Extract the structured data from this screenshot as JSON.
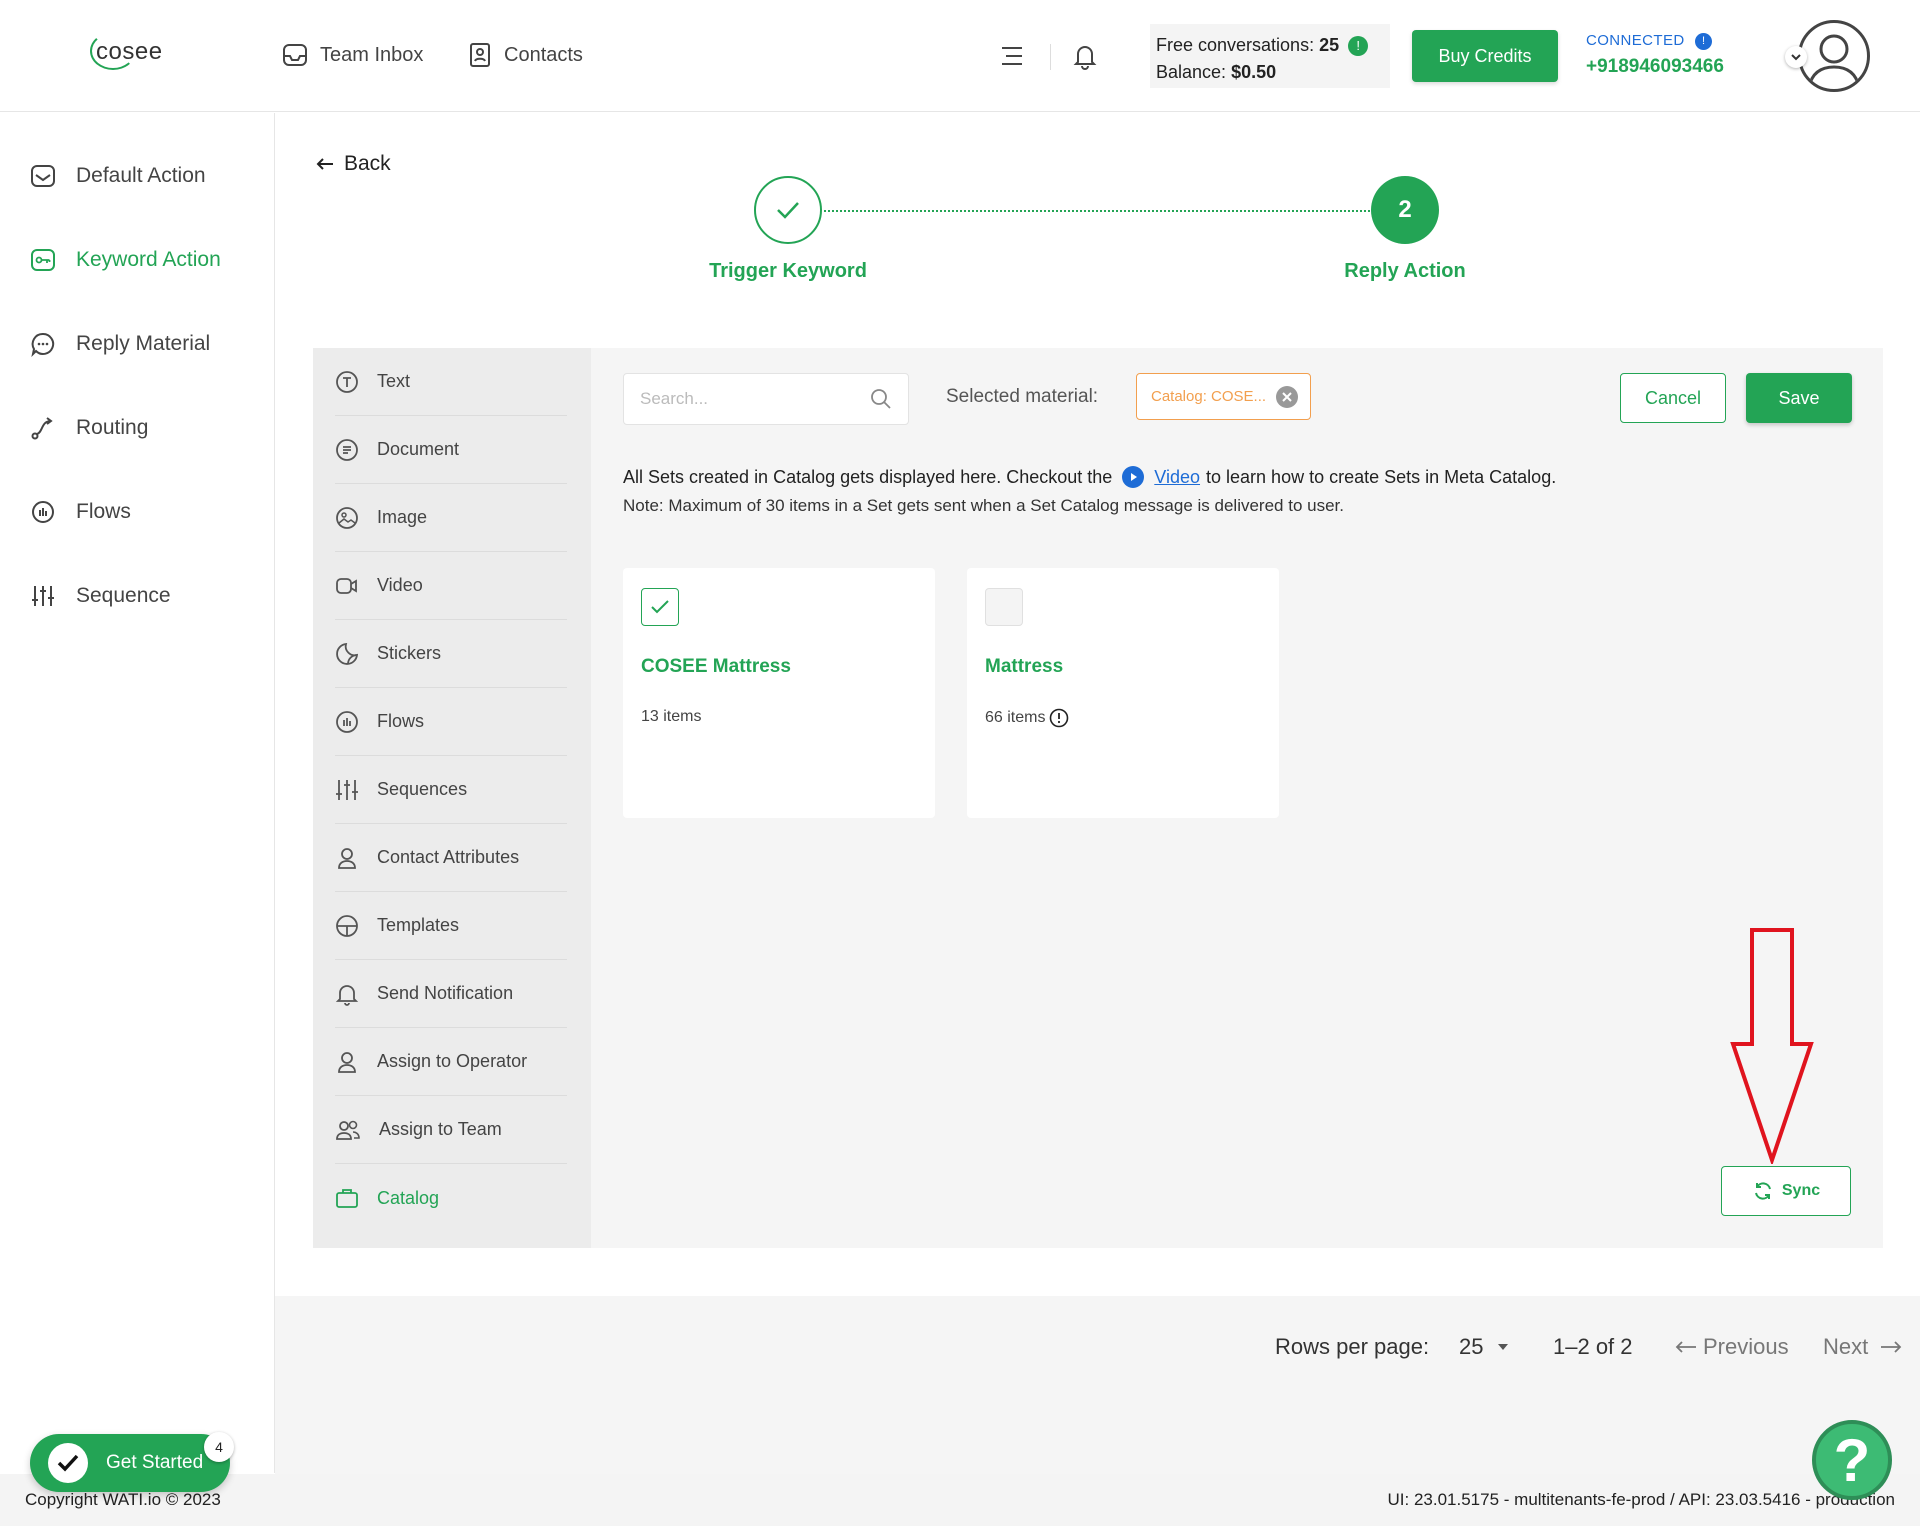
{
  "header": {
    "logo": "cosee",
    "nav": [
      {
        "label": "Team Inbox",
        "icon": "inbox-icon"
      },
      {
        "label": "Contacts",
        "icon": "contacts-icon"
      }
    ],
    "free_conversations_label": "Free conversations:",
    "free_conversations_value": "25",
    "balance_label": "Balance:",
    "balance_value": "$0.50",
    "buy_credits": "Buy Credits",
    "status": "CONNECTED",
    "phone": "+918946093466"
  },
  "sidebar": {
    "items": [
      {
        "label": "Default Action",
        "icon": "inbox-icon"
      },
      {
        "label": "Keyword Action",
        "icon": "key-icon"
      },
      {
        "label": "Reply Material",
        "icon": "chat-bubble-icon"
      },
      {
        "label": "Routing",
        "icon": "routing-icon"
      },
      {
        "label": "Flows",
        "icon": "flows-icon"
      },
      {
        "label": "Sequence",
        "icon": "sliders-icon"
      }
    ],
    "active": "Keyword Action"
  },
  "back_label": "Back",
  "steps": [
    {
      "label": "Trigger Keyword",
      "state": "done"
    },
    {
      "number": "2",
      "label": "Reply Action",
      "state": "active"
    }
  ],
  "materials": {
    "items": [
      {
        "label": "Text",
        "icon": "text-icon"
      },
      {
        "label": "Document",
        "icon": "document-icon"
      },
      {
        "label": "Image",
        "icon": "image-icon"
      },
      {
        "label": "Video",
        "icon": "video-icon"
      },
      {
        "label": "Stickers",
        "icon": "sticker-icon"
      },
      {
        "label": "Flows",
        "icon": "flows-icon"
      },
      {
        "label": "Sequences",
        "icon": "sliders-icon"
      },
      {
        "label": "Contact Attributes",
        "icon": "person-icon"
      },
      {
        "label": "Templates",
        "icon": "template-icon"
      },
      {
        "label": "Send Notification",
        "icon": "bell-icon"
      },
      {
        "label": "Assign to Operator",
        "icon": "person-icon"
      },
      {
        "label": "Assign to Team",
        "icon": "team-icon"
      },
      {
        "label": "Catalog",
        "icon": "catalog-icon"
      }
    ],
    "active": "Catalog"
  },
  "toolbar": {
    "search_placeholder": "Search...",
    "selected_material_label": "Selected material:",
    "selected_material_value": "Catalog: COSE...",
    "cancel": "Cancel",
    "save": "Save"
  },
  "info": {
    "line1_before": "All Sets created in Catalog gets displayed here. Checkout the",
    "video_link": "Video",
    "line1_after": "to learn how to create Sets in Meta Catalog.",
    "line2": "Note: Maximum of 30 items in a Set gets sent when a Set Catalog message is delivered to user."
  },
  "sets": [
    {
      "name": "COSEE Mattress",
      "count": "13 items",
      "selected": true
    },
    {
      "name": "Mattress",
      "count": "66 items",
      "selected": false
    }
  ],
  "sync_label": "Sync",
  "pagination": {
    "rows_per_page_label": "Rows per page:",
    "rows_per_page_value": "25",
    "range": "1–2 of 2",
    "previous": "Previous",
    "next": "Next"
  },
  "footer": {
    "copyright": "Copyright WATI.io © 2023",
    "version": "UI: 23.01.5175 - multitenants-fe-prod / API: 23.03.5416 - production"
  },
  "get_started": {
    "label": "Get Started",
    "badge": "4"
  },
  "colors": {
    "brand_green": "#23a455",
    "link_blue": "#1e6cd6",
    "chip_orange": "#f29f4e",
    "annotation_red": "#e0141e"
  }
}
